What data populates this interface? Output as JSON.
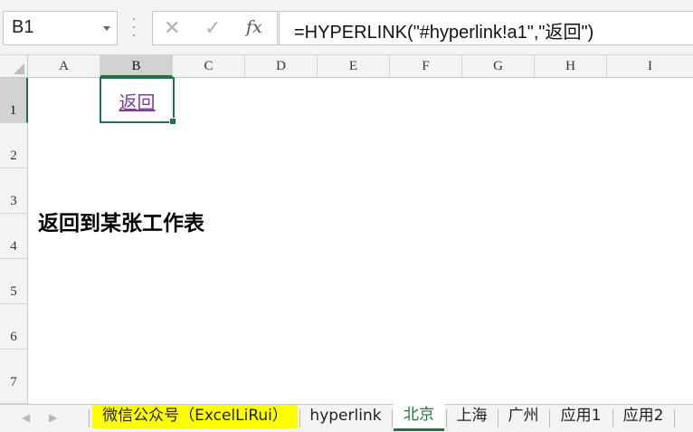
{
  "formula_bar": {
    "name_box": "B1",
    "cancel_icon": "✕",
    "enter_icon": "✓",
    "fx_label": "fx",
    "formula": "=HYPERLINK(\"#hyperlink!a1\",\"返回\")"
  },
  "columns": [
    "A",
    "B",
    "C",
    "D",
    "E",
    "F",
    "G",
    "H",
    "I"
  ],
  "selected_column": "B",
  "rows": [
    "1",
    "2",
    "3",
    "4",
    "5",
    "6",
    "7"
  ],
  "selected_row": "1",
  "cells": {
    "B1": "返回",
    "A3_4": "返回到某张工作表"
  },
  "sheet_tabs": [
    {
      "label": "微信公众号（ExcelLiRui）",
      "highlight": "yellow"
    },
    {
      "label": "hyperlink"
    },
    {
      "label": "北京",
      "active": true
    },
    {
      "label": "上海"
    },
    {
      "label": "广州"
    },
    {
      "label": "应用1"
    },
    {
      "label": "应用2"
    }
  ],
  "colors": {
    "accent": "#217346",
    "link": "#7b3e97",
    "tab_highlight": "#ffff00"
  }
}
